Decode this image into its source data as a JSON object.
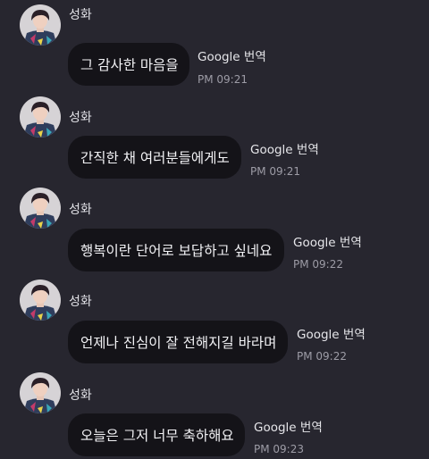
{
  "messages": [
    {
      "sender": "성화",
      "text": "그 감사한 마음을",
      "translate_label": "Google 번역",
      "time": "PM 09:21"
    },
    {
      "sender": "성화",
      "text": "간직한 채 여러분들에게도",
      "translate_label": "Google 번역",
      "time": "PM 09:21"
    },
    {
      "sender": "성화",
      "text": "행복이란 단어로 보답하고 싶네요",
      "translate_label": "Google 번역",
      "time": "PM 09:22"
    },
    {
      "sender": "성화",
      "text": "언제나 진심이 잘 전해지길 바라며",
      "translate_label": "Google 번역",
      "time": "PM 09:22"
    },
    {
      "sender": "성화",
      "text": "오늘은 그저 너무 축하해요",
      "translate_label": "Google 번역",
      "time": "PM 09:23"
    }
  ]
}
